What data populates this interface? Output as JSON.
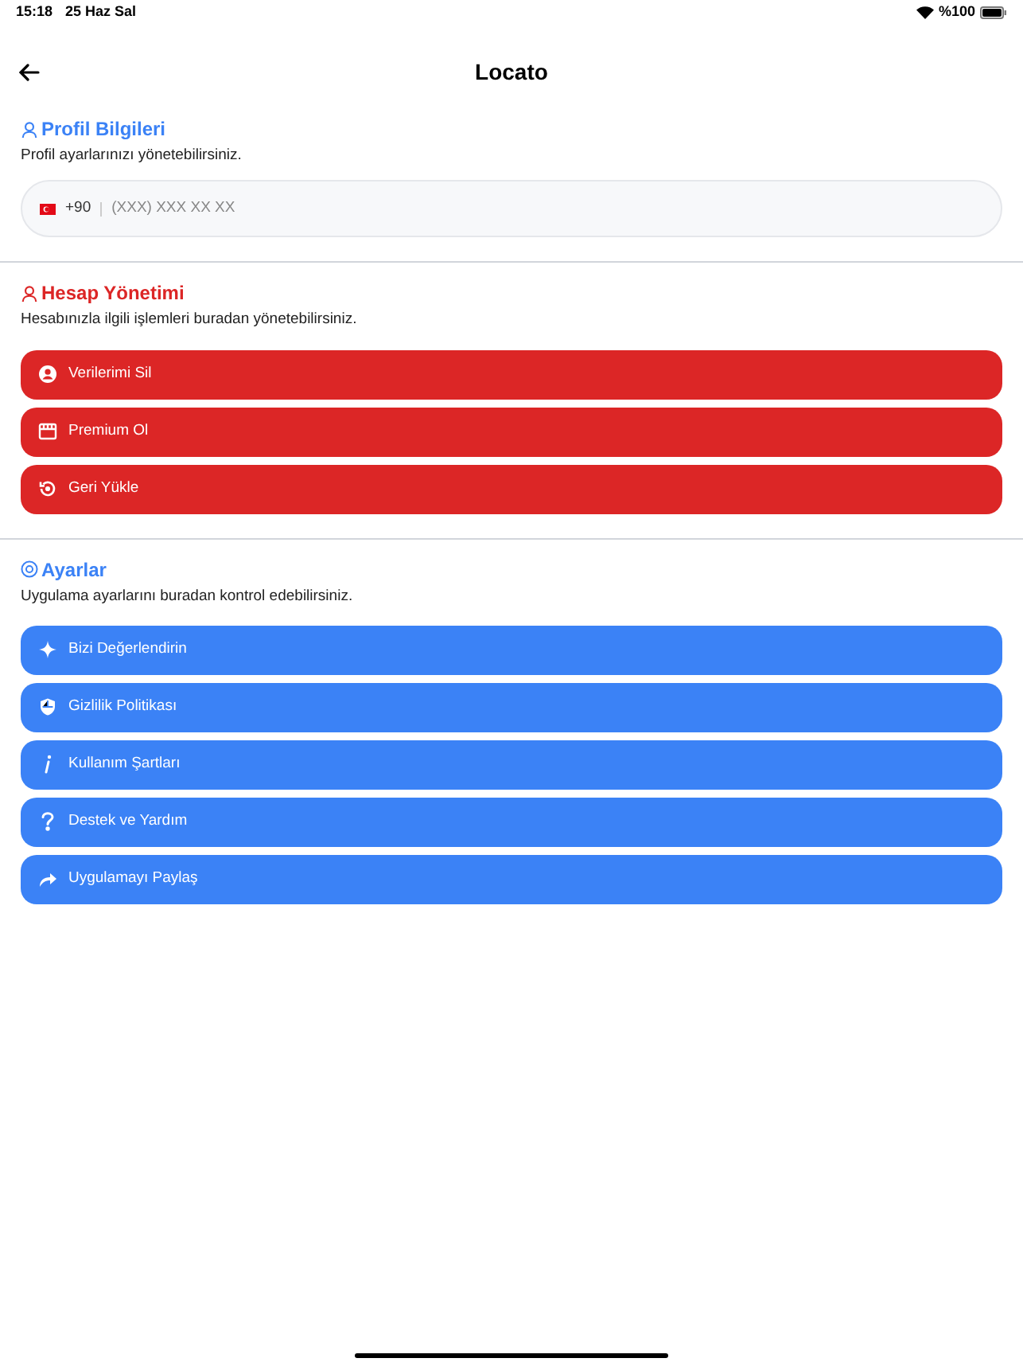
{
  "status_bar": {
    "time": "15:18",
    "date": "25 Haz Sal",
    "battery": "%100"
  },
  "header": {
    "title": "Locato"
  },
  "profile": {
    "title": "Profil Bilgileri",
    "subtitle": "Profil ayarlarınızı yönetebilirsiniz.",
    "color": "#3b82f6",
    "phone": {
      "code": "+90",
      "placeholder": "(XXX) XXX XX XX"
    }
  },
  "sections": [
    {
      "title": "Hesap Yönetimi",
      "subtitle": "Hesabınızla ilgili işlemleri buradan yönetebilirsiniz.",
      "color": "#dc2626",
      "buttons": [
        {
          "label": "Verilerimi Sil"
        },
        {
          "label": "Premium Ol"
        },
        {
          "label": "Geri Yükle"
        }
      ]
    },
    {
      "title": "Ayarlar",
      "subtitle": "Uygulama ayarlarını buradan kontrol edebilirsiniz.",
      "color": "#3b82f6",
      "buttons": [
        {
          "label": "Bizi Değerlendirin"
        },
        {
          "label": "Gizlilik Politikası"
        },
        {
          "label": "Kullanım Şartları"
        },
        {
          "label": "Destek ve Yardım"
        },
        {
          "label": "Uygulamayı Paylaş"
        }
      ]
    }
  ]
}
